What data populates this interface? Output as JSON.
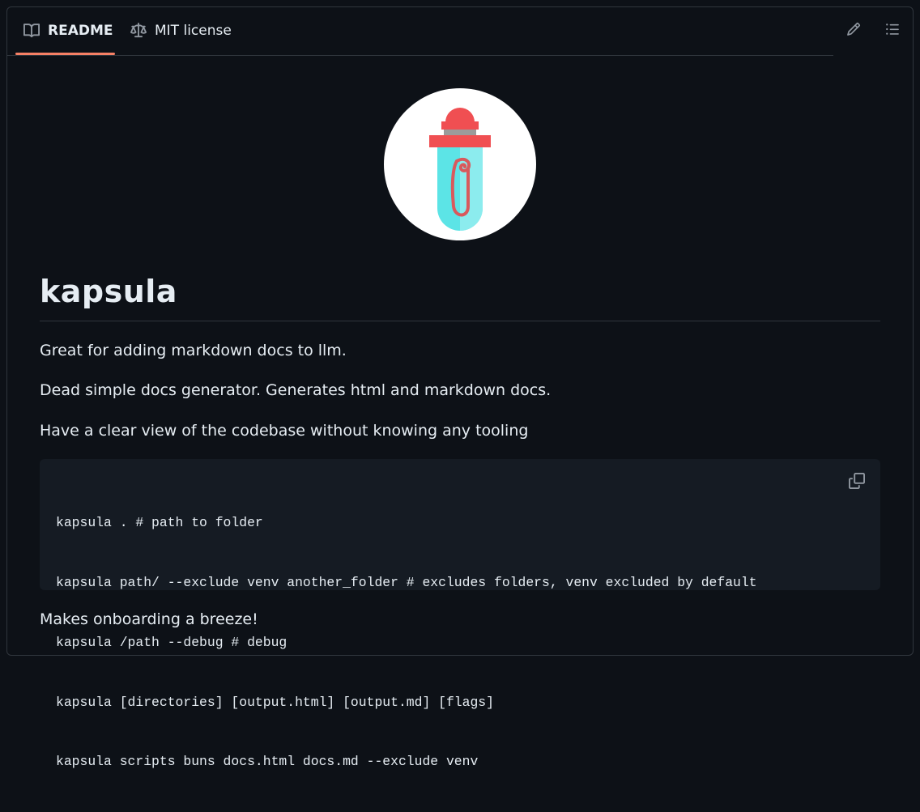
{
  "tabs": [
    {
      "label": "README",
      "icon": "book-icon",
      "active": true
    },
    {
      "label": "MIT license",
      "icon": "scale-icon",
      "active": false
    }
  ],
  "actions": {
    "edit_icon": "pencil-icon",
    "outline_icon": "list-icon"
  },
  "readme": {
    "logo_icon": "kapsula-dropper-logo",
    "title": "kapsula",
    "paragraphs": [
      "Great for adding markdown docs to llm.",
      "Dead simple docs generator. Generates html and markdown docs.",
      "Have a clear view of the codebase without knowing any tooling"
    ],
    "code_lines": [
      "kapsula . # path to folder",
      "kapsula path/ --exclude venv another_folder # excludes folders, venv excluded by default",
      "kapsula /path --debug # debug",
      "kapsula [directories] [output.html] [output.md] [flags]",
      "kapsula scripts buns docs.html docs.md --exclude venv"
    ],
    "copy_icon": "copy-icon",
    "closing": "Makes onboarding a breeze!"
  },
  "colors": {
    "background": "#0d1117",
    "border": "#30363d",
    "active_tab_underline": "#f78166",
    "code_background": "#151b23",
    "text": "#e6edf3",
    "muted_icon": "#9198a1"
  }
}
